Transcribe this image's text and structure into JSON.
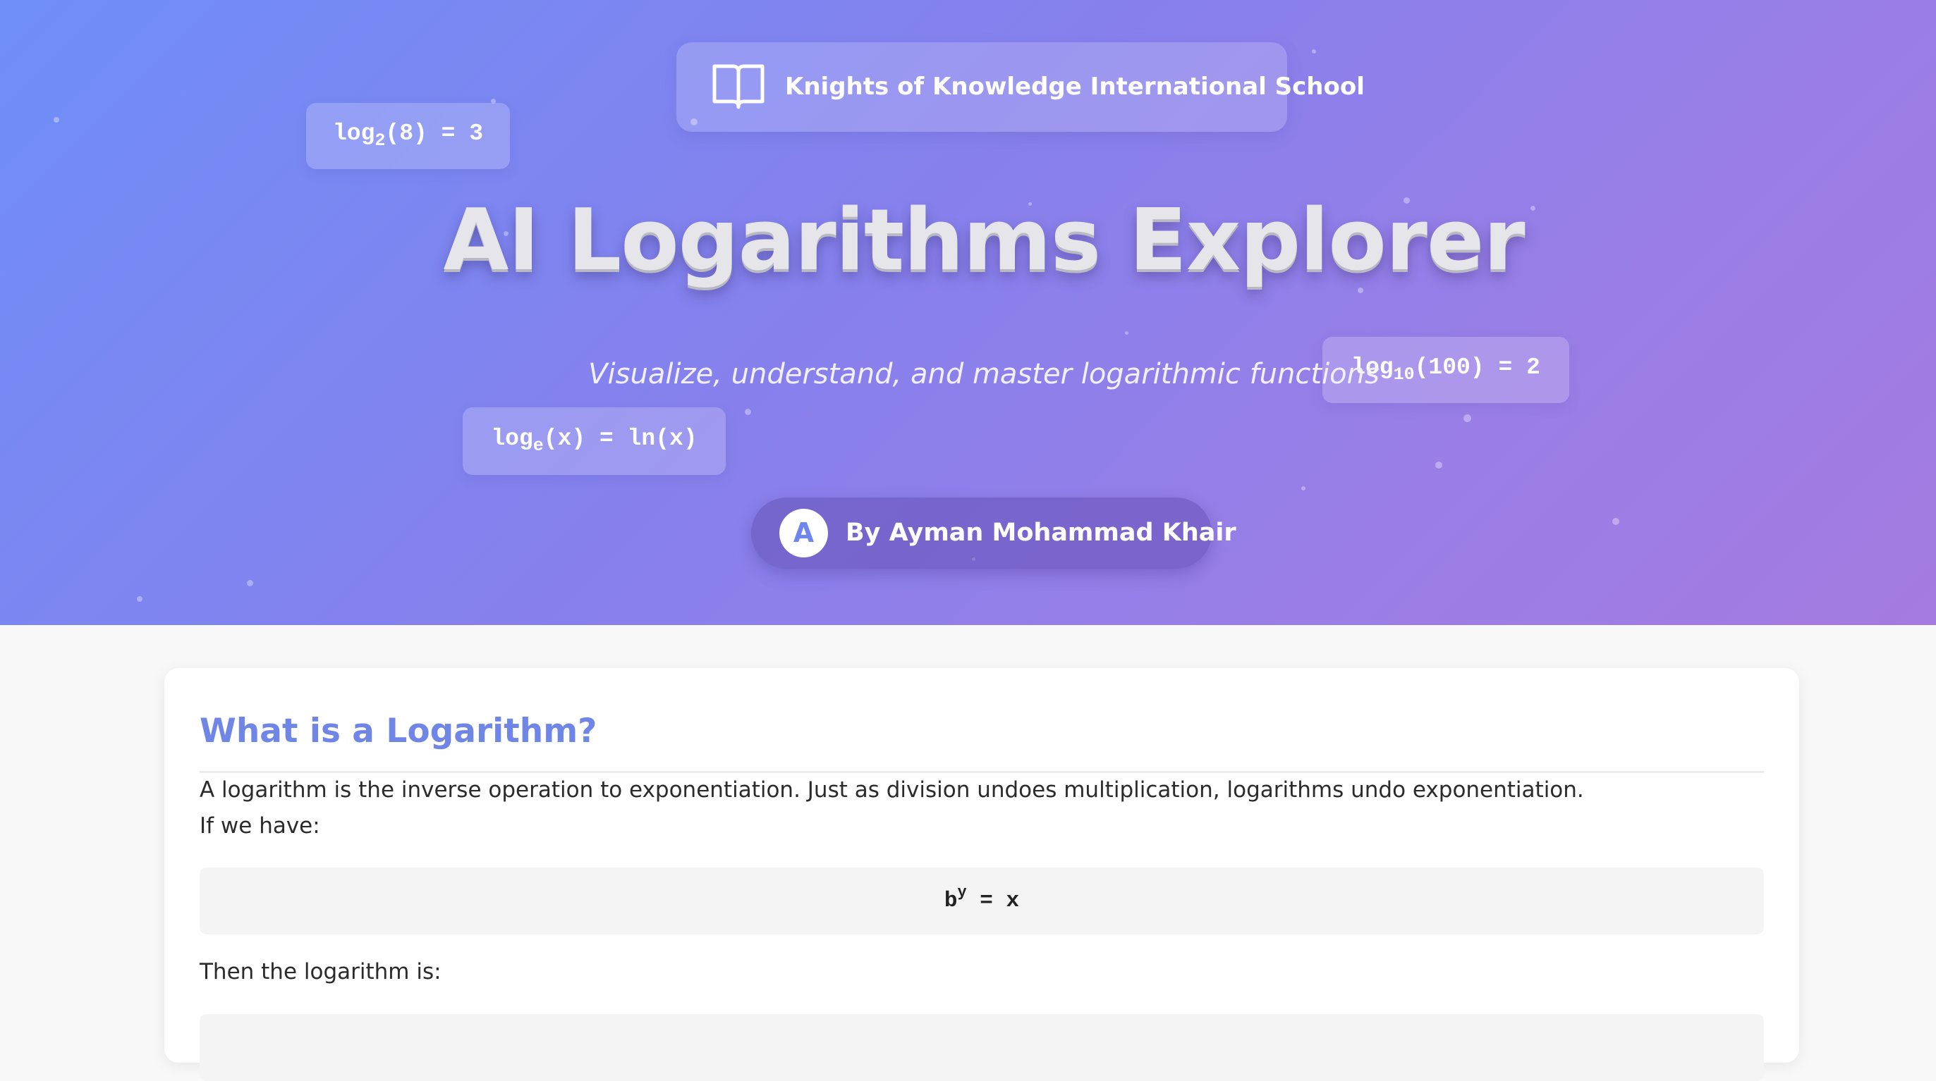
{
  "header": {
    "school": {
      "icon": "open-book-icon",
      "name": "Knights of Knowledge International School"
    },
    "title": "AI Logarithms Explorer",
    "subtitle": "Visualize, understand, and master logarithmic functions",
    "floating_formulas": [
      {
        "base": "log",
        "sub": "2",
        "rest": "(8) = 3"
      },
      {
        "base": "log",
        "sub": "10",
        "rest": "(100) = 2"
      },
      {
        "base": "log",
        "sub": "e",
        "rest": "(x) = ln(x)"
      }
    ],
    "author": {
      "avatar_letter": "A",
      "label": "By Ayman Mohammad Khair"
    }
  },
  "section": {
    "heading": "What is a Logarithm?",
    "paragraph1": "A logarithm is the inverse operation to exponentiation. Just as division undoes multiplication, logarithms undo exponentiation.",
    "paragraph2": "If we have:",
    "formula1": {
      "base": "b",
      "exponent": "y",
      "rest": " = x"
    },
    "paragraph3": "Then the logarithm is:"
  },
  "colors": {
    "gradient_start": "#6f8ef8",
    "gradient_end": "#a47be0",
    "heading_accent": "#6f86e6",
    "page_background": "#f8f8f8"
  }
}
